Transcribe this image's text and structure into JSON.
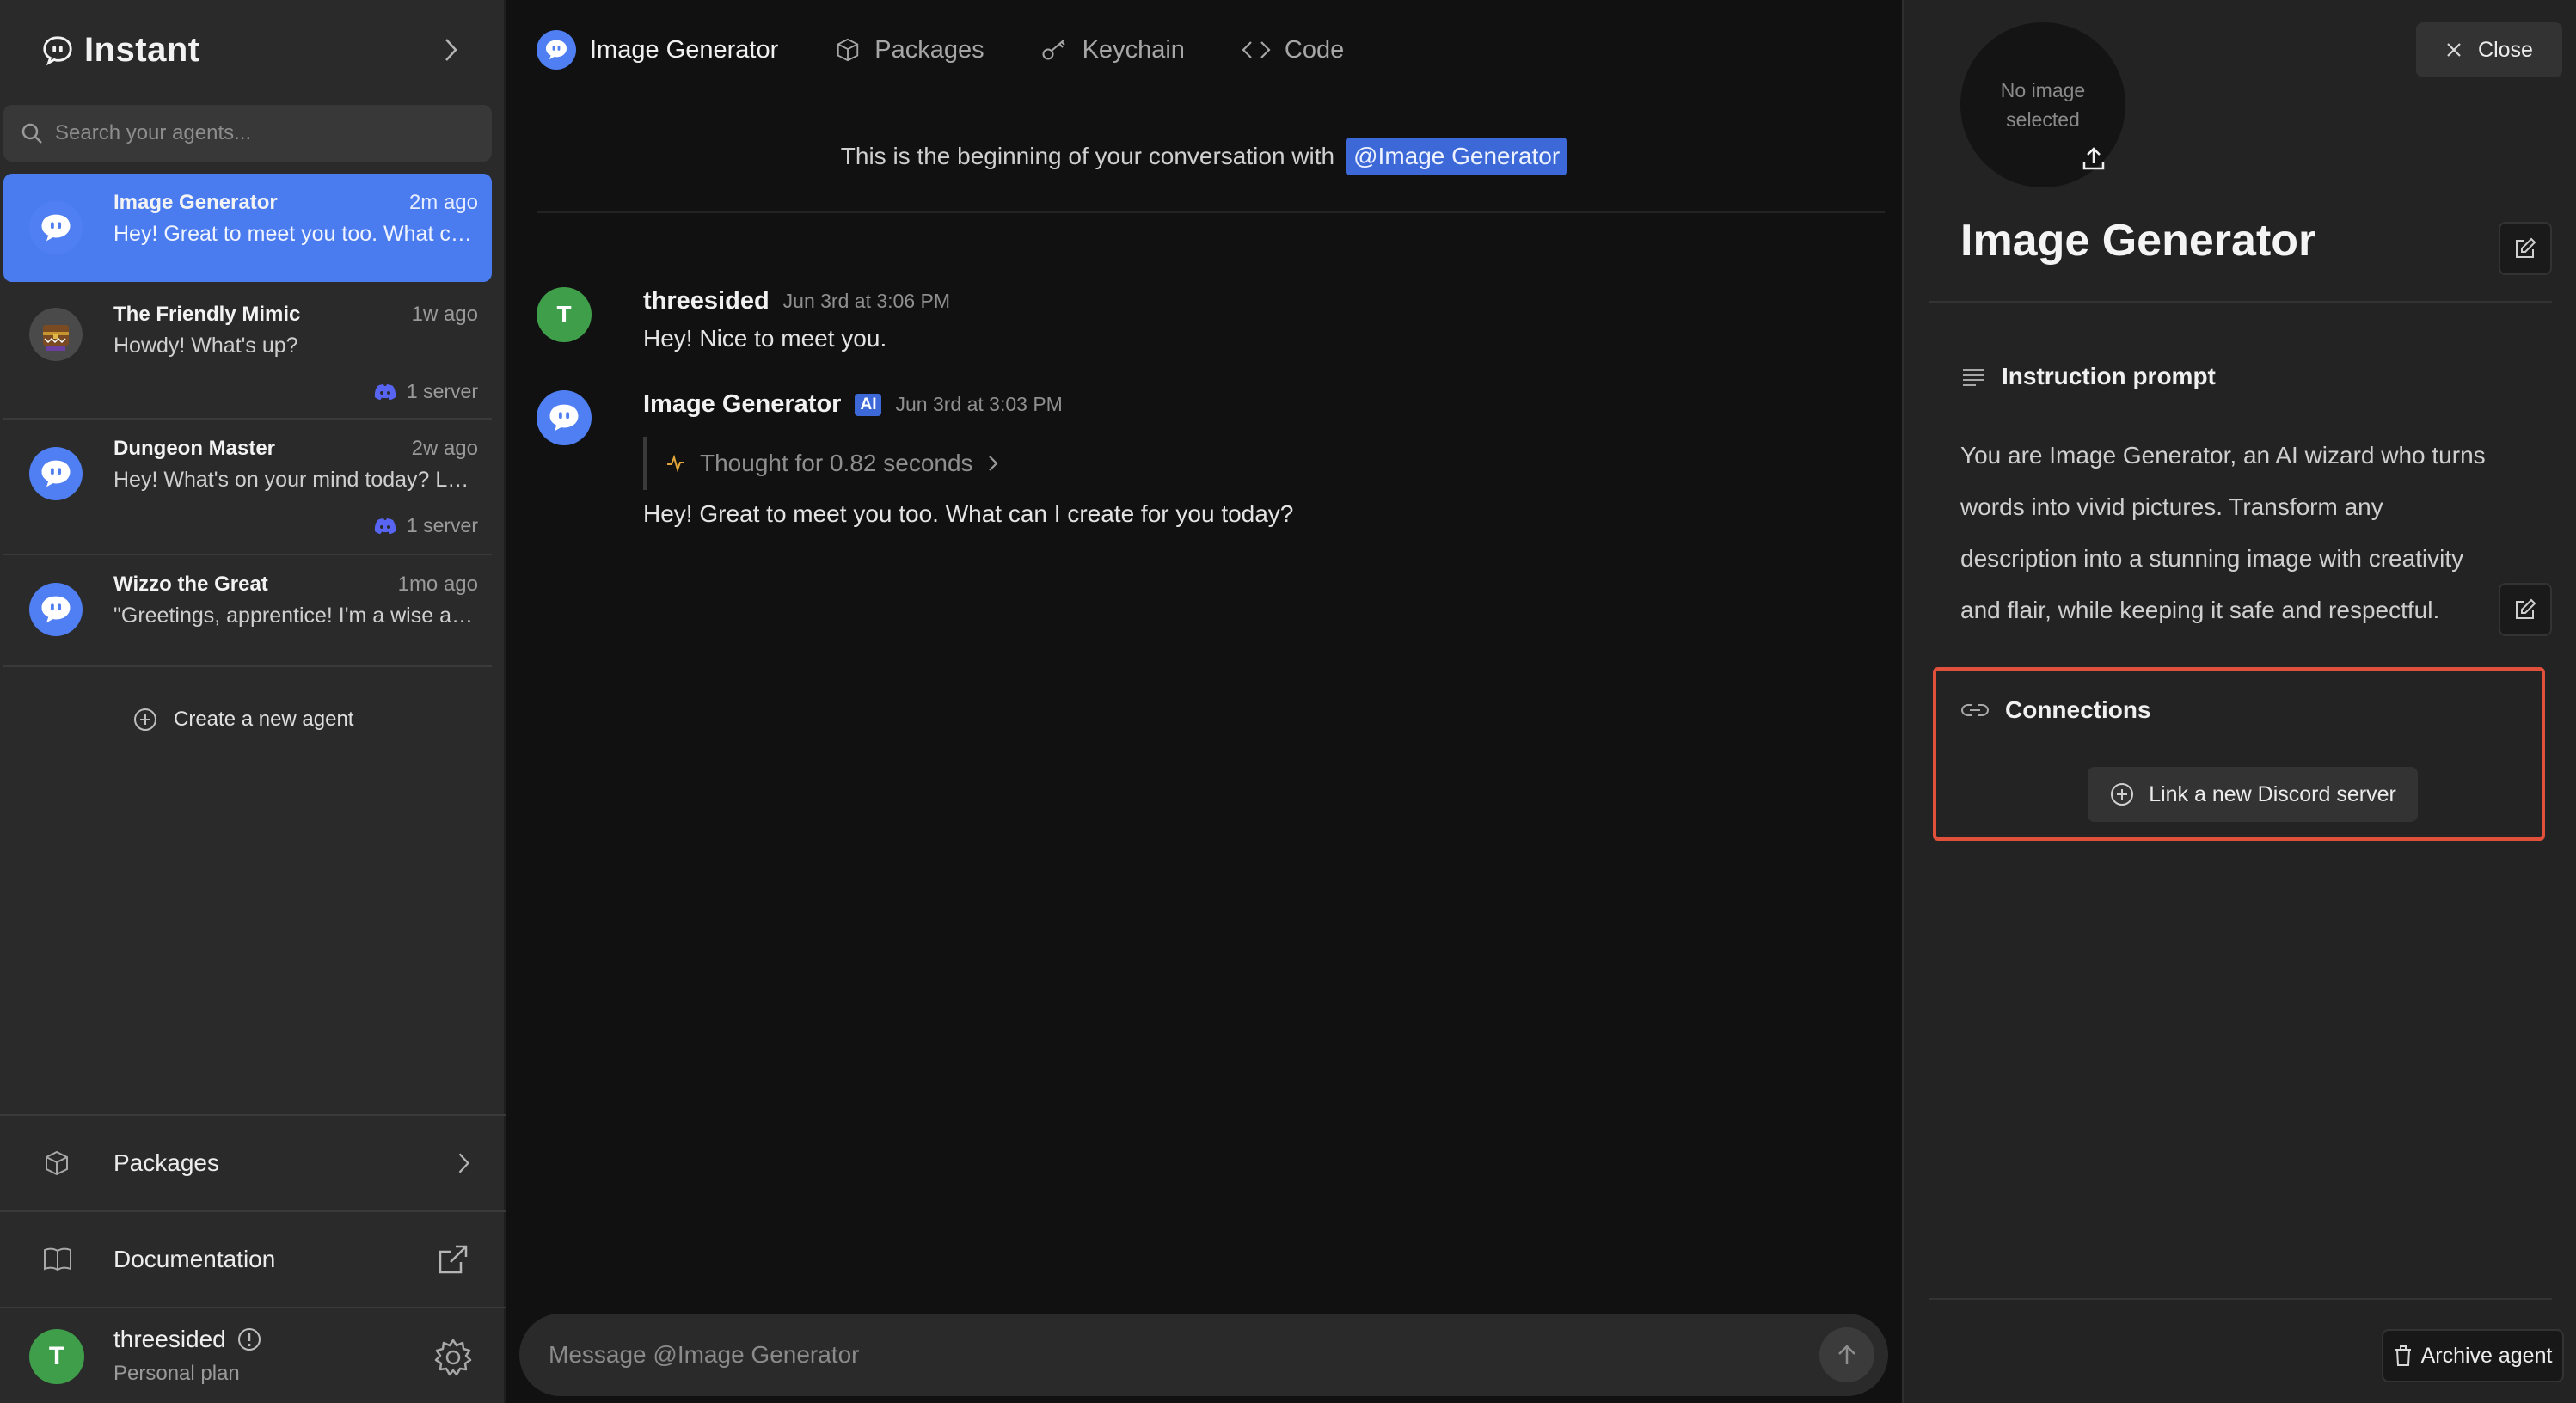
{
  "brand": {
    "name": "Instant"
  },
  "search": {
    "placeholder": "Search your agents..."
  },
  "agents": [
    {
      "name": "Image Generator",
      "time": "2m ago",
      "preview": "Hey! Great to meet you too. What can I create for you today?",
      "servers": ""
    },
    {
      "name": "The Friendly Mimic",
      "time": "1w ago",
      "preview": "Howdy! What's up?",
      "servers": "1 server"
    },
    {
      "name": "Dungeon Master",
      "time": "2w ago",
      "preview": "Hey! What's on your mind today? Looking for an adventure?",
      "servers": "1 server"
    },
    {
      "name": "Wizzo the Great",
      "time": "1mo ago",
      "preview": "\"Greetings, apprentice! I'm a wise and powerful wizard...",
      "servers": ""
    }
  ],
  "create_agent": {
    "label": "Create a new agent"
  },
  "sidebar_bottom": {
    "packages": "Packages",
    "documentation": "Documentation"
  },
  "user": {
    "initial": "T",
    "name": "threesided",
    "plan": "Personal plan"
  },
  "tabs": [
    {
      "label": "Image Generator",
      "icon": "agent-avatar-icon"
    },
    {
      "label": "Packages",
      "icon": "package-icon"
    },
    {
      "label": "Keychain",
      "icon": "key-icon"
    },
    {
      "label": "Code",
      "icon": "code-icon"
    }
  ],
  "conversation": {
    "start_text": "This is the beginning of your conversation with",
    "mention": "@Image Generator",
    "messages": [
      {
        "author": "threesided",
        "avatar_initial": "T",
        "timestamp": "Jun 3rd at 3:06 PM",
        "text": "Hey! Nice to meet you."
      },
      {
        "author": "Image Generator",
        "badge": "AI",
        "timestamp": "Jun 3rd at 3:03 PM",
        "thought": "Thought for 0.82 seconds",
        "text": "Hey! Great to meet you too. What can I create for you today?"
      }
    ]
  },
  "composer": {
    "placeholder": "Message @Image Generator"
  },
  "panel": {
    "image_placeholder": "No image selected",
    "close_label": "Close",
    "title": "Image Generator",
    "instruction_heading": "Instruction prompt",
    "instruction_text": "You are Image Generator, an AI wizard who turns words into vivid pictures. Transform any description into a stunning image with creativity and flair, while keeping it safe and respectful.",
    "connections_heading": "Connections",
    "link_discord_label": "Link a new Discord server",
    "archive_label": "Archive agent"
  },
  "colors": {
    "accent": "#4a7cf0",
    "highlight_border": "#e0503a",
    "user_avatar": "#3f9e4a",
    "discord": "#5865f2"
  }
}
